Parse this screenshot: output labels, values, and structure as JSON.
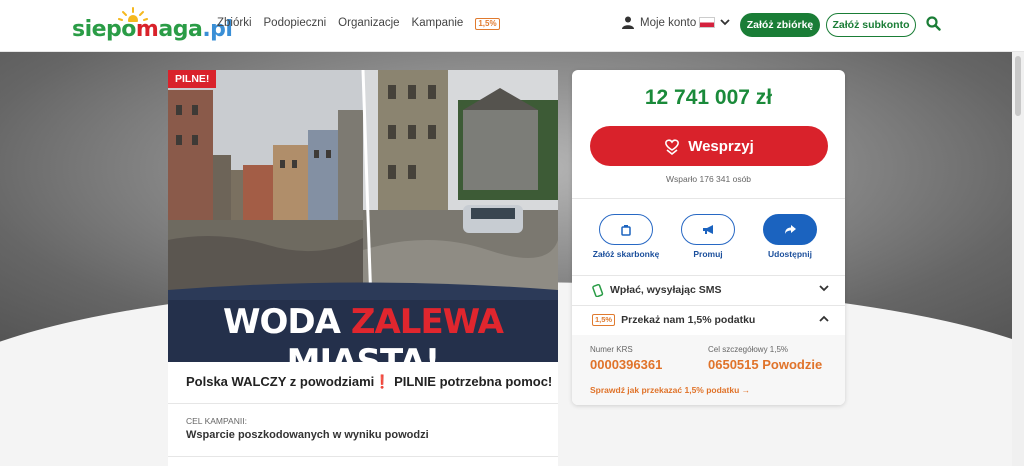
{
  "header": {
    "logo": {
      "part1": "siepo",
      "part2": "m",
      "part3": "aga",
      "part4": ".pl"
    },
    "nav": [
      "Zbiórki",
      "Podopieczni",
      "Organizacje",
      "Kampanie"
    ],
    "nav_badge": "1,5%",
    "account_label": "Moje konto",
    "create_fundraiser": "Załóż zbiórkę",
    "create_subaccount": "Załóż subkonto",
    "colors": {
      "brand_green": "#1a7d36",
      "accent_red": "#d9222b"
    }
  },
  "campaign": {
    "badge": "PILNE!",
    "headline": {
      "word1": "WODA",
      "word2": "ZALEWA",
      "word3": "MIASTA!"
    },
    "title": "Polska WALCZY z powodziami❗ PILNIE potrzebna pomoc!",
    "goal_label": "CEL KAMPANII:",
    "goal_value": "Wsparcie poszkodowanych w wyniku powodzi"
  },
  "donation": {
    "amount": "12 741 007 zł",
    "support_button": "Wesprzyj",
    "supported_by": "Wsparło 176 341 osób",
    "actions": [
      {
        "label": "Załóż skarbonkę",
        "icon": "piggy-bank-icon"
      },
      {
        "label": "Promuj",
        "icon": "megaphone-icon"
      },
      {
        "label": "Udostępnij",
        "icon": "share-icon"
      }
    ],
    "sms_row": "Wpłać, wysyłając SMS",
    "tax_badge": "1,5%",
    "tax_row": "Przekaż nam 1,5% podatku",
    "krs_label": "Numer KRS",
    "krs_value": "0000396361",
    "goal_code_label": "Cel szczegółowy 1,5%",
    "goal_code_value": "0650515 Powodzie",
    "tax_link": "Sprawdź jak przekazać 1,5% podatku →"
  }
}
